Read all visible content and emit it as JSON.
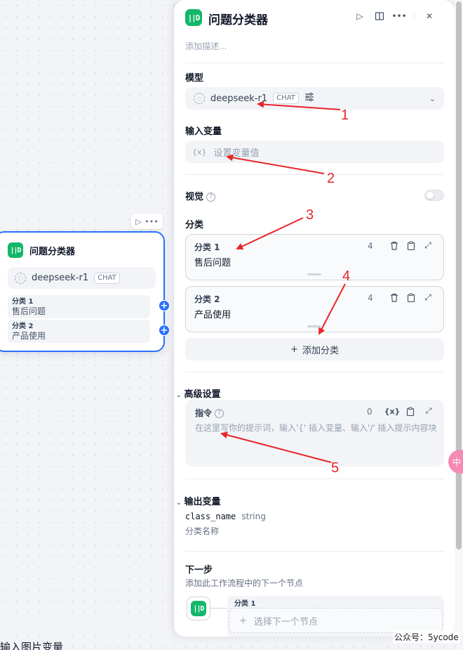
{
  "node": {
    "title": "问题分类器",
    "model": "deepseek-r1",
    "model_tag": "CHAT",
    "classes": [
      {
        "name": "分类 1",
        "text": "售后问题"
      },
      {
        "name": "分类 2",
        "text": "产品使用"
      }
    ]
  },
  "panel": {
    "title": "问题分类器",
    "description_placeholder": "添加描述...",
    "model_label": "模型",
    "model_name": "deepseek-r1",
    "model_tag": "CHAT",
    "input_var_label": "输入变量",
    "input_var_icon_text": "{x}",
    "input_var_placeholder": "设置变量值",
    "vision_label": "视觉",
    "vision_enabled": false,
    "classes_label": "分类",
    "classes": [
      {
        "name": "分类 1",
        "text": "售后问题",
        "count": "4"
      },
      {
        "name": "分类 2",
        "text": "产品使用",
        "count": "4"
      }
    ],
    "add_class_label": "添加分类",
    "advanced_label": "高级设置",
    "instruction_label": "指令",
    "instruction_count": "0",
    "instruction_var_icon_text": "{x}",
    "instruction_placeholder": "在这里写你的提示词，输入'{' 插入变量、输入'/' 插入提示内容块",
    "output_label": "输出变量",
    "output_var_name": "class_name",
    "output_var_type": "string",
    "output_var_desc": "分类名称",
    "next_label": "下一步",
    "next_desc": "添加此工作流程中的下一个节点",
    "next_class_name": "分类 1",
    "next_select_placeholder": "选择下一个节点"
  },
  "canvas_bottom_text": "输入图片变量",
  "watermark": "公众号：5ycode",
  "pink_button_text": "中",
  "annotations": [
    "1",
    "2",
    "3",
    "4",
    "5"
  ],
  "colors": {
    "accent": "#2970ff",
    "node_icon": "#12b76a",
    "annotation": "#e6262b"
  }
}
